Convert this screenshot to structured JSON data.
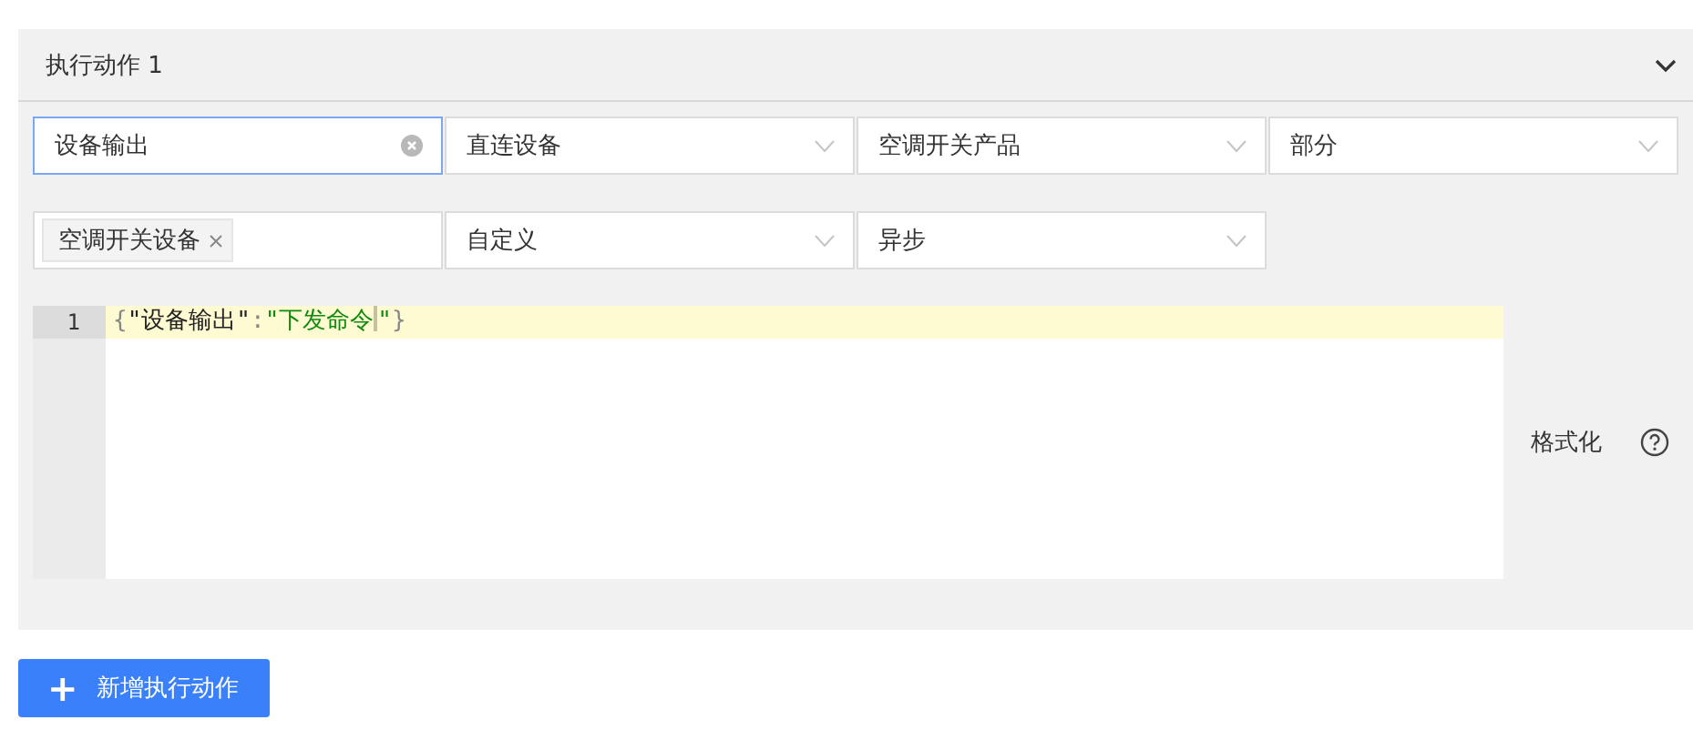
{
  "panel": {
    "title": "执行动作 1",
    "expanded": true
  },
  "field_rows": [
    [
      {
        "kind": "input",
        "value": "设备输出",
        "focused": true,
        "clearable": true
      },
      {
        "kind": "select",
        "value": "直连设备"
      },
      {
        "kind": "select",
        "value": "空调开关产品"
      },
      {
        "kind": "select",
        "value": "部分"
      }
    ],
    [
      {
        "kind": "tags",
        "tags": [
          "空调开关设备"
        ]
      },
      {
        "kind": "select",
        "value": "自定义"
      },
      {
        "kind": "select",
        "value": "异步"
      }
    ]
  ],
  "editor": {
    "lines": [
      {
        "number": "1",
        "active": true,
        "tokens": [
          {
            "kind": "punct",
            "text": "{"
          },
          {
            "kind": "key",
            "text": "\"设备输出\""
          },
          {
            "kind": "punct",
            "text": ":"
          },
          {
            "kind": "string",
            "text": "\"下发命令"
          },
          {
            "kind": "cursor"
          },
          {
            "kind": "string",
            "text": "\""
          },
          {
            "kind": "punct",
            "text": "}"
          }
        ]
      }
    ]
  },
  "format_label": "格式化",
  "add_button": {
    "icon": "+",
    "label": "新增执行动作"
  }
}
